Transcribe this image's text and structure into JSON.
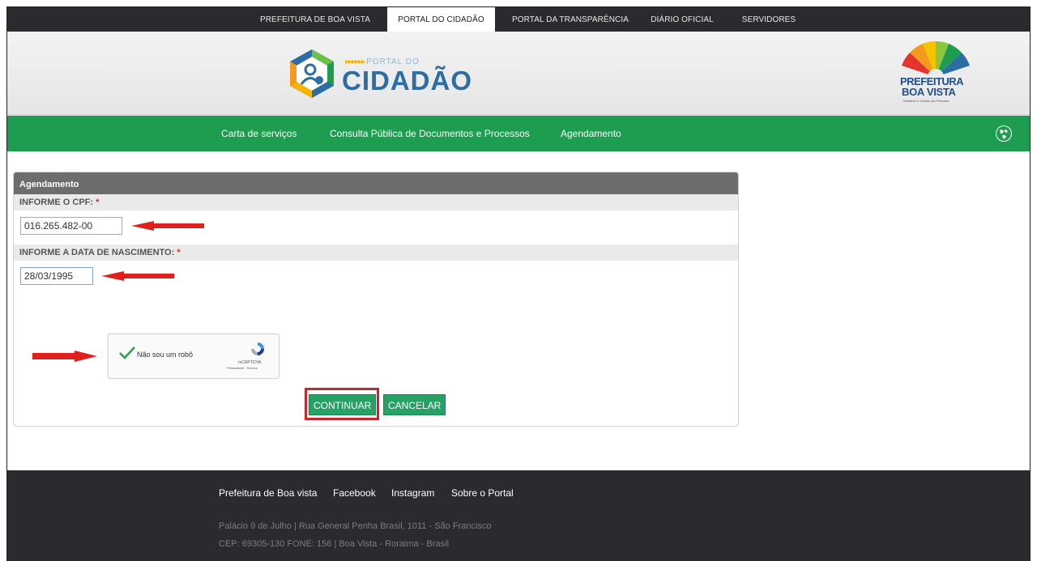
{
  "topbar": {
    "tabs": [
      "PREFEITURA DE BOA VISTA",
      "PORTAL DO CIDADÃO",
      "PORTAL DA TRANSPARÊNCIA",
      "DIÁRIO OFICIAL",
      "SERVIDORES"
    ],
    "active_tab": "PORTAL DO CIDADÃO"
  },
  "header": {
    "logo_small": "PORTAL DO",
    "logo_big": "CIDADÃO",
    "pref_line1": "PREFEITURA",
    "pref_line2": "BOA VISTA",
    "pref_tagline": "Trabalhar e Cuidar das Pessoas"
  },
  "nav": {
    "items": [
      "Carta de serviços",
      "Consulta Pública de Documentos e Processos",
      "Agendamento"
    ],
    "globe_icon": "globe-icon"
  },
  "form": {
    "title": "Agendamento",
    "cpf_label": "INFORME O CPF:",
    "cpf_value": "016.265.482-00",
    "dob_label": "INFORME A DATA DE NASCIMENTO:",
    "dob_value": "28/03/1995",
    "required_mark": "*",
    "captcha_label": "Não sou um robô",
    "captcha_brand": "reCAPTCHA",
    "captcha_terms": "Privacidade - Termos",
    "continue_label": "CONTINUAR",
    "cancel_label": "CANCELAR"
  },
  "footer": {
    "links": [
      "Prefeitura de Boa vista",
      "Facebook",
      "Instagram",
      "Sobre o Portal"
    ],
    "address": "Palácio 9 de Julho | Rua General Penha Brasil, 1011 - São Francisco",
    "contact": "CEP: 69305-130 FONE: 156 | Boa Vista - Roraima - Brasil"
  },
  "colors": {
    "nav_green": "#1e9c4f",
    "button_green": "#27a267",
    "annotation_red": "#e0201f",
    "dark": "#2b2a2e"
  }
}
